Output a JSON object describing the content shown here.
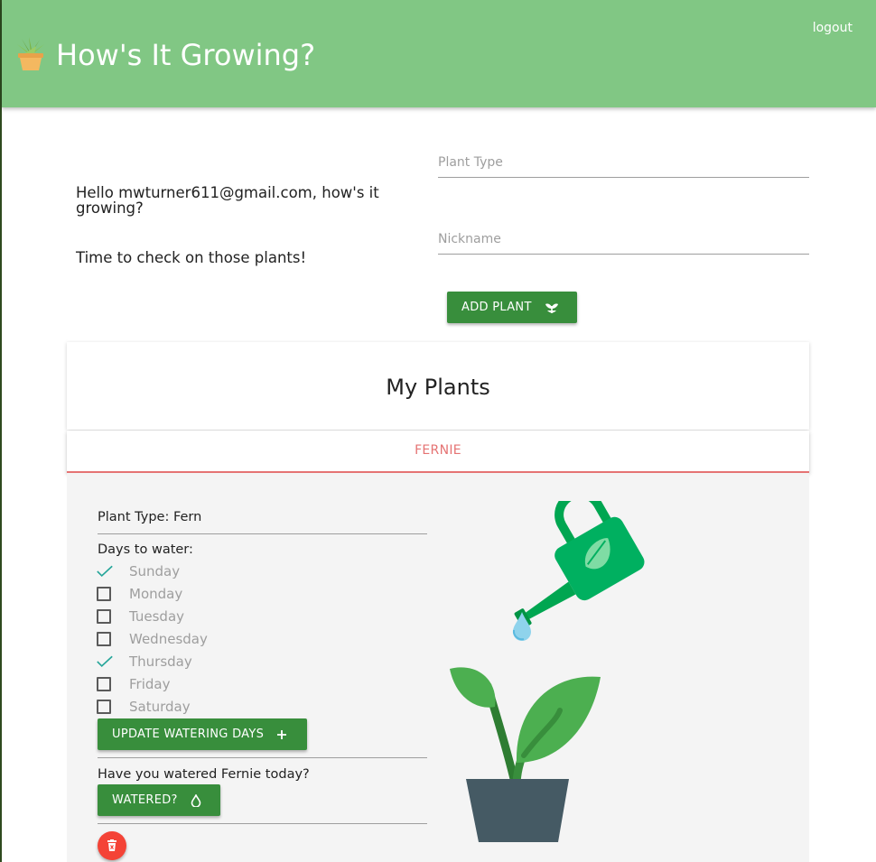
{
  "header": {
    "title": "How's It Growing?",
    "logout_label": "logout",
    "background": "#81c784"
  },
  "welcome": {
    "greeting": "Hello mwturner611@gmail.com, how's it growing?",
    "subtitle": "Time to check on those plants!"
  },
  "add_form": {
    "plant_type_placeholder": "Plant Type",
    "nickname_placeholder": "Nickname",
    "add_button_label": "ADD PLANT",
    "add_button_icon": "sprout-icon"
  },
  "plants_section": {
    "heading": "My Plants",
    "tabs": [
      {
        "label": "FERNIE",
        "active": true
      }
    ]
  },
  "plant": {
    "type_line": "Plant Type: Fern",
    "days_label": "Days to water:",
    "days": [
      {
        "label": "Sunday",
        "checked": true
      },
      {
        "label": "Monday",
        "checked": false
      },
      {
        "label": "Tuesday",
        "checked": false
      },
      {
        "label": "Wednesday",
        "checked": false
      },
      {
        "label": "Thursday",
        "checked": true
      },
      {
        "label": "Friday",
        "checked": false
      },
      {
        "label": "Saturday",
        "checked": false
      }
    ],
    "update_button_label": "UPDATE WATERING DAYS",
    "update_button_icon": "plus-icon",
    "watered_question": "Have you watered Fernie today?",
    "watered_button_label": "WATERED?",
    "watered_button_icon": "water-drop-icon",
    "delete_icon": "trash-icon",
    "illustration": "watering-can-and-plant-illustration"
  },
  "colors": {
    "primary_button": "#388e3c",
    "tab_accent": "#e57373",
    "checkmark": "#26a69a",
    "delete": "#f44336",
    "panel_bg": "#f4f4f4"
  }
}
